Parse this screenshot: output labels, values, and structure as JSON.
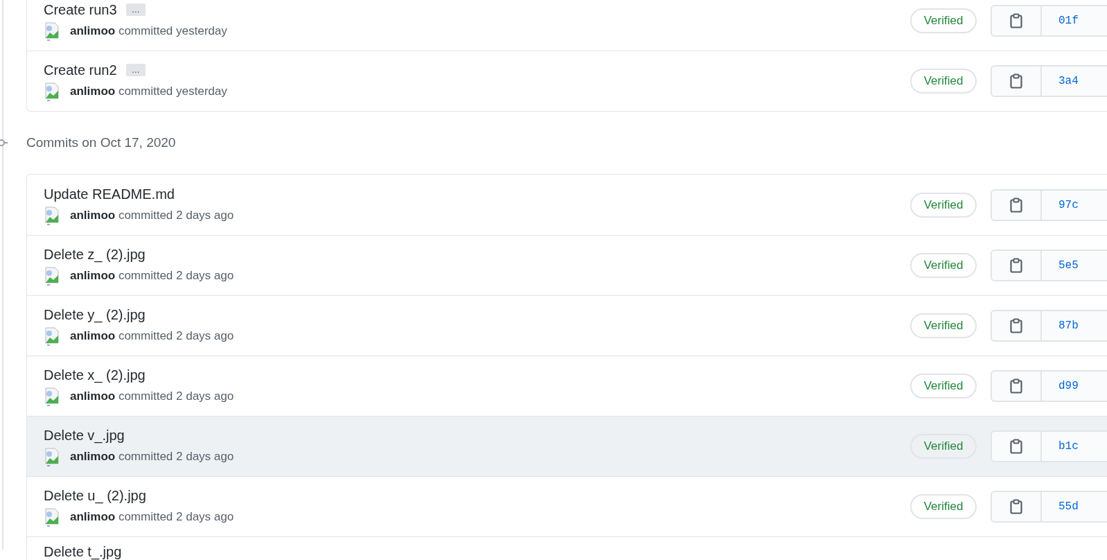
{
  "groups": [
    {
      "commits": [
        {
          "title": "Create run3",
          "ellipsis": "…",
          "author": "anlimoo",
          "action": "committed yesterday",
          "badge": "Verified",
          "hash": "01f",
          "selected": false
        },
        {
          "title": "Create run2",
          "ellipsis": "…",
          "author": "anlimoo",
          "action": "committed yesterday",
          "badge": "Verified",
          "hash": "3a4",
          "selected": false
        }
      ]
    },
    {
      "heading": "Commits on Oct 17, 2020",
      "commits": [
        {
          "title": "Update README.md",
          "author": "anlimoo",
          "action": "committed 2 days ago",
          "badge": "Verified",
          "hash": "97c",
          "selected": false
        },
        {
          "title": "Delete z_ (2).jpg",
          "author": "anlimoo",
          "action": "committed 2 days ago",
          "badge": "Verified",
          "hash": "5e5",
          "selected": false
        },
        {
          "title": "Delete y_ (2).jpg",
          "author": "anlimoo",
          "action": "committed 2 days ago",
          "badge": "Verified",
          "hash": "87b",
          "selected": false
        },
        {
          "title": "Delete x_ (2).jpg",
          "author": "anlimoo",
          "action": "committed 2 days ago",
          "badge": "Verified",
          "hash": "d99",
          "selected": false
        },
        {
          "title": "Delete v_.jpg",
          "author": "anlimoo",
          "action": "committed 2 days ago",
          "badge": "Verified",
          "hash": "b1c",
          "selected": true
        },
        {
          "title": "Delete u_ (2).jpg",
          "author": "anlimoo",
          "action": "committed 2 days ago",
          "badge": "Verified",
          "hash": "55d",
          "selected": false
        },
        {
          "title": "Delete t_.jpg"
        }
      ]
    }
  ]
}
